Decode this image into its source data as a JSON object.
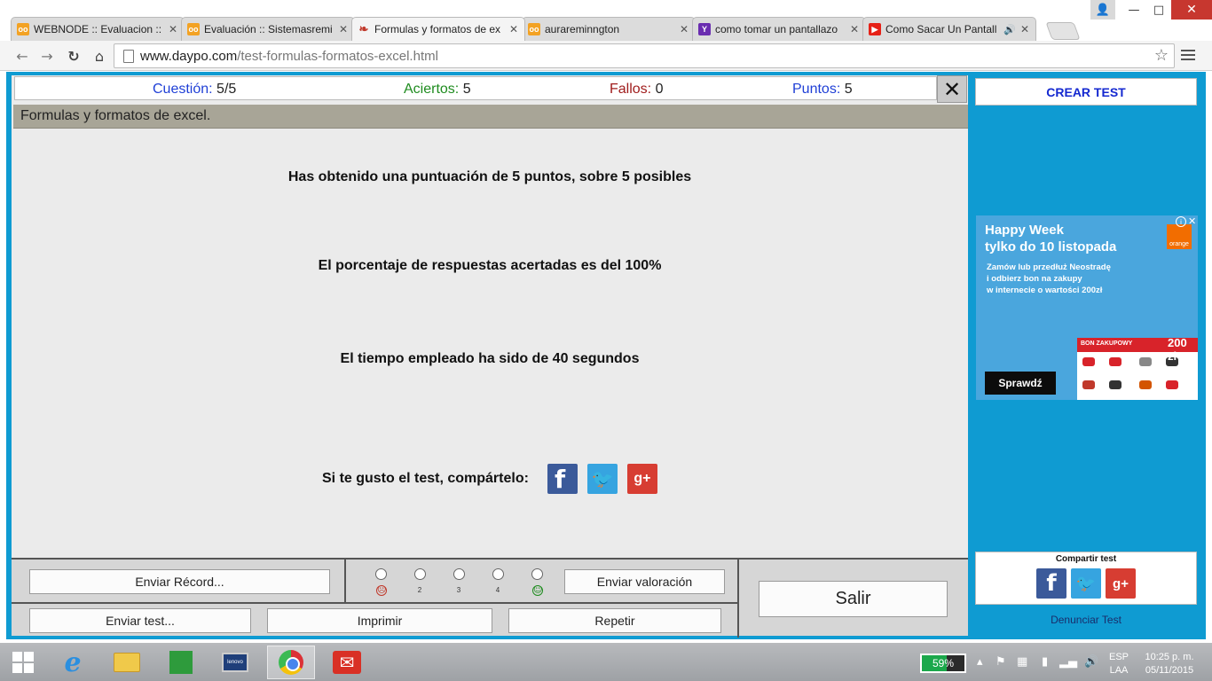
{
  "browser": {
    "tabs": [
      {
        "title": "WEBNODE :: Evaluacion ::",
        "favicon": "webnode-icon",
        "active": false
      },
      {
        "title": "Evaluación :: Sistemasremi",
        "favicon": "webnode-icon",
        "active": false
      },
      {
        "title": "Formulas y formatos de ex",
        "favicon": "daypo-icon",
        "active": true
      },
      {
        "title": "aurareminngton",
        "favicon": "webnode-icon",
        "active": false
      },
      {
        "title": "como tomar un pantallazo",
        "favicon": "yahoo-icon",
        "active": false
      },
      {
        "title": "Como Sacar Un Pantall",
        "favicon": "youtube-icon",
        "active": false,
        "audio": true
      }
    ],
    "url_host": "www.daypo.com",
    "url_path": "/test-formulas-formatos-excel.html"
  },
  "stats": {
    "question_label": "Cuestión:",
    "question_value": "5/5",
    "correct_label": "Aciertos:",
    "correct_value": "5",
    "wrong_label": "Fallos:",
    "wrong_value": "0",
    "points_label": "Puntos:",
    "points_value": "5"
  },
  "test_title": "Formulas y formatos de excel.",
  "results": {
    "score": "Has obtenido una puntuación de 5 puntos, sobre 5 posibles",
    "percentage": "El porcentaje de respuestas acertadas es del 100%",
    "time": "El tiempo empleado ha sido de 40 segundos",
    "share_prompt": "Si te gusto el test, compártelo:"
  },
  "controls": {
    "send_record": "Enviar Récord...",
    "send_rating": "Enviar valoración",
    "send_test": "Enviar test...",
    "print": "Imprimir",
    "repeat": "Repetir",
    "exit": "Salir",
    "rating_labels": [
      "2",
      "3",
      "4"
    ]
  },
  "sidebar": {
    "create_test": "CREAR TEST",
    "share_title": "Compartir test",
    "report": "Denunciar Test",
    "ad": {
      "headline1": "Happy Week",
      "headline2": "tylko do 10 listopada",
      "body": "Zamów lub przedłuż Neostradę\ni odbierz bon na zakupy\nw internecie o wartości 200zł",
      "cta": "Sprawdź",
      "logo": "orange",
      "voucher_label": "BON ZAKUPOWY",
      "voucher_amount": "200 zł"
    }
  },
  "taskbar": {
    "battery": "59%",
    "battery_level": 0.59,
    "language": "ESP",
    "layout": "LAA",
    "time": "10:25 p. m.",
    "date": "05/11/2015"
  },
  "colors": {
    "page_bg": "#0f9bd2",
    "panel_bg": "#ebebeb",
    "title_bar": "#a8a597",
    "question_blue": "#1f3fd6",
    "correct_green": "#1f8c1f",
    "wrong_red": "#a01d1d"
  }
}
